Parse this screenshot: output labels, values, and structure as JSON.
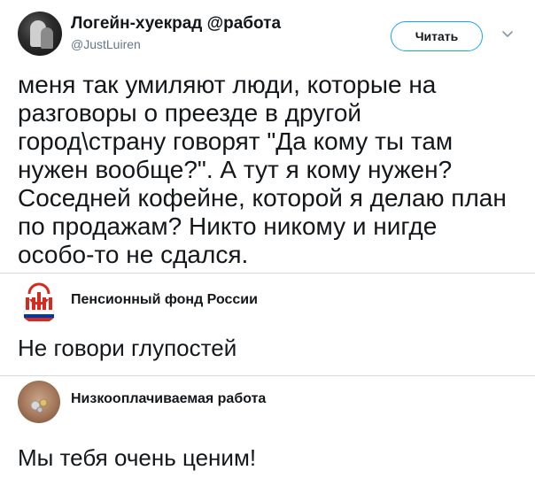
{
  "tweet": {
    "author_name": "Логейн-хуекрад @работа",
    "author_handle": "@JustLuiren",
    "follow_label": "Читать",
    "text_lines": [
      "меня так умиляют люди, которые на",
      "разговоры о преезде в другой",
      "город\\страну говорят \"Да кому ты там",
      "нужен вообще?\". А тут я кому нужен?",
      "Соседней кофейне, которой я делаю план",
      "по продажам? Никто никому и нигде",
      "особо-то не сдался."
    ]
  },
  "replies": [
    {
      "name": "Пенсионный фонд России",
      "text": "Не говори глупостей"
    },
    {
      "name": "Низкооплачиваемая работа",
      "text": "Мы тебя очень ценим!"
    }
  ],
  "colors": {
    "accent": "#1da1f2",
    "text": "#14171a",
    "muted": "#657786",
    "divider": "#d9d9d9",
    "pfr_red": "#d52b1e",
    "pfr_blue": "#0039a6"
  }
}
